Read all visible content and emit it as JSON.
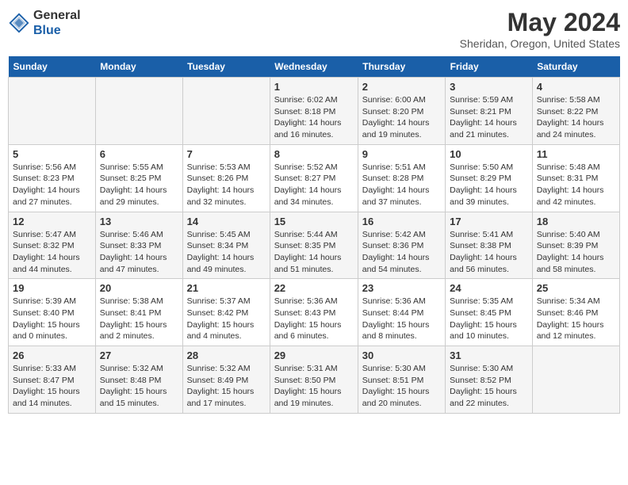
{
  "header": {
    "logo_general": "General",
    "logo_blue": "Blue",
    "month_title": "May 2024",
    "location": "Sheridan, Oregon, United States"
  },
  "weekdays": [
    "Sunday",
    "Monday",
    "Tuesday",
    "Wednesday",
    "Thursday",
    "Friday",
    "Saturday"
  ],
  "weeks": [
    [
      {
        "day": "",
        "info": ""
      },
      {
        "day": "",
        "info": ""
      },
      {
        "day": "",
        "info": ""
      },
      {
        "day": "1",
        "info": "Sunrise: 6:02 AM\nSunset: 8:18 PM\nDaylight: 14 hours and 16 minutes."
      },
      {
        "day": "2",
        "info": "Sunrise: 6:00 AM\nSunset: 8:20 PM\nDaylight: 14 hours and 19 minutes."
      },
      {
        "day": "3",
        "info": "Sunrise: 5:59 AM\nSunset: 8:21 PM\nDaylight: 14 hours and 21 minutes."
      },
      {
        "day": "4",
        "info": "Sunrise: 5:58 AM\nSunset: 8:22 PM\nDaylight: 14 hours and 24 minutes."
      }
    ],
    [
      {
        "day": "5",
        "info": "Sunrise: 5:56 AM\nSunset: 8:23 PM\nDaylight: 14 hours and 27 minutes."
      },
      {
        "day": "6",
        "info": "Sunrise: 5:55 AM\nSunset: 8:25 PM\nDaylight: 14 hours and 29 minutes."
      },
      {
        "day": "7",
        "info": "Sunrise: 5:53 AM\nSunset: 8:26 PM\nDaylight: 14 hours and 32 minutes."
      },
      {
        "day": "8",
        "info": "Sunrise: 5:52 AM\nSunset: 8:27 PM\nDaylight: 14 hours and 34 minutes."
      },
      {
        "day": "9",
        "info": "Sunrise: 5:51 AM\nSunset: 8:28 PM\nDaylight: 14 hours and 37 minutes."
      },
      {
        "day": "10",
        "info": "Sunrise: 5:50 AM\nSunset: 8:29 PM\nDaylight: 14 hours and 39 minutes."
      },
      {
        "day": "11",
        "info": "Sunrise: 5:48 AM\nSunset: 8:31 PM\nDaylight: 14 hours and 42 minutes."
      }
    ],
    [
      {
        "day": "12",
        "info": "Sunrise: 5:47 AM\nSunset: 8:32 PM\nDaylight: 14 hours and 44 minutes."
      },
      {
        "day": "13",
        "info": "Sunrise: 5:46 AM\nSunset: 8:33 PM\nDaylight: 14 hours and 47 minutes."
      },
      {
        "day": "14",
        "info": "Sunrise: 5:45 AM\nSunset: 8:34 PM\nDaylight: 14 hours and 49 minutes."
      },
      {
        "day": "15",
        "info": "Sunrise: 5:44 AM\nSunset: 8:35 PM\nDaylight: 14 hours and 51 minutes."
      },
      {
        "day": "16",
        "info": "Sunrise: 5:42 AM\nSunset: 8:36 PM\nDaylight: 14 hours and 54 minutes."
      },
      {
        "day": "17",
        "info": "Sunrise: 5:41 AM\nSunset: 8:38 PM\nDaylight: 14 hours and 56 minutes."
      },
      {
        "day": "18",
        "info": "Sunrise: 5:40 AM\nSunset: 8:39 PM\nDaylight: 14 hours and 58 minutes."
      }
    ],
    [
      {
        "day": "19",
        "info": "Sunrise: 5:39 AM\nSunset: 8:40 PM\nDaylight: 15 hours and 0 minutes."
      },
      {
        "day": "20",
        "info": "Sunrise: 5:38 AM\nSunset: 8:41 PM\nDaylight: 15 hours and 2 minutes."
      },
      {
        "day": "21",
        "info": "Sunrise: 5:37 AM\nSunset: 8:42 PM\nDaylight: 15 hours and 4 minutes."
      },
      {
        "day": "22",
        "info": "Sunrise: 5:36 AM\nSunset: 8:43 PM\nDaylight: 15 hours and 6 minutes."
      },
      {
        "day": "23",
        "info": "Sunrise: 5:36 AM\nSunset: 8:44 PM\nDaylight: 15 hours and 8 minutes."
      },
      {
        "day": "24",
        "info": "Sunrise: 5:35 AM\nSunset: 8:45 PM\nDaylight: 15 hours and 10 minutes."
      },
      {
        "day": "25",
        "info": "Sunrise: 5:34 AM\nSunset: 8:46 PM\nDaylight: 15 hours and 12 minutes."
      }
    ],
    [
      {
        "day": "26",
        "info": "Sunrise: 5:33 AM\nSunset: 8:47 PM\nDaylight: 15 hours and 14 minutes."
      },
      {
        "day": "27",
        "info": "Sunrise: 5:32 AM\nSunset: 8:48 PM\nDaylight: 15 hours and 15 minutes."
      },
      {
        "day": "28",
        "info": "Sunrise: 5:32 AM\nSunset: 8:49 PM\nDaylight: 15 hours and 17 minutes."
      },
      {
        "day": "29",
        "info": "Sunrise: 5:31 AM\nSunset: 8:50 PM\nDaylight: 15 hours and 19 minutes."
      },
      {
        "day": "30",
        "info": "Sunrise: 5:30 AM\nSunset: 8:51 PM\nDaylight: 15 hours and 20 minutes."
      },
      {
        "day": "31",
        "info": "Sunrise: 5:30 AM\nSunset: 8:52 PM\nDaylight: 15 hours and 22 minutes."
      },
      {
        "day": "",
        "info": ""
      }
    ]
  ]
}
